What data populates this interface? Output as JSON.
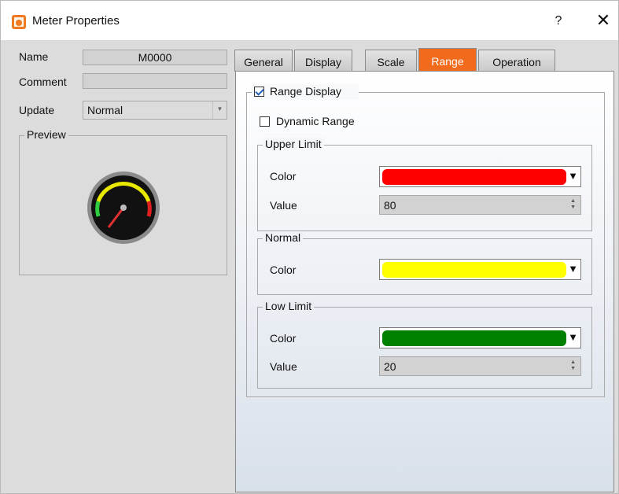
{
  "window": {
    "title": "Meter Properties",
    "help": "?",
    "close": "✕"
  },
  "left": {
    "name_label": "Name",
    "name_value": "M0000",
    "comment_label": "Comment",
    "comment_value": "",
    "update_label": "Update",
    "update_value": "Normal",
    "preview_label": "Preview"
  },
  "tabs": [
    {
      "label": "General"
    },
    {
      "label": "Display"
    },
    {
      "label": "Scale"
    },
    {
      "label": "Range"
    },
    {
      "label": "Operation"
    }
  ],
  "active_tab": "Range",
  "range": {
    "range_display_label": "Range Display",
    "range_display_checked": true,
    "dynamic_range_label": "Dynamic Range",
    "dynamic_range_checked": false,
    "upper": {
      "title": "Upper Limit",
      "color_label": "Color",
      "color": "#ff0000",
      "value_label": "Value",
      "value": "80"
    },
    "normal": {
      "title": "Normal",
      "color_label": "Color",
      "color": "#ffff00"
    },
    "low": {
      "title": "Low Limit",
      "color_label": "Color",
      "color": "#008000",
      "value_label": "Value",
      "value": "20"
    }
  },
  "colors": {
    "accent": "#f26a1b"
  },
  "icons": {
    "app": "meter-app-icon",
    "dropdown": "triangle-down",
    "spin": "spin-up-down"
  }
}
